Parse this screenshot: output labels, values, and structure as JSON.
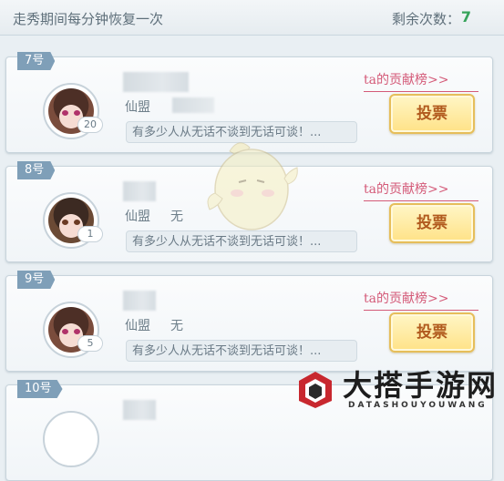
{
  "header": {
    "hint": "走秀期间每分钟恢复一次",
    "remaining_label": "剩余次数：",
    "remaining_count": "7"
  },
  "entries": [
    {
      "rank": "7号",
      "level": "20",
      "clan_label": "仙盟",
      "clan_value": "",
      "motto": "有多少人从无话不谈到无话可谈！...",
      "contrib_link": "ta的贡献榜>>",
      "vote_label": "投票"
    },
    {
      "rank": "8号",
      "level": "1",
      "clan_label": "仙盟",
      "clan_value": "无",
      "motto": "有多少人从无话不谈到无话可谈！...",
      "contrib_link": "ta的贡献榜>>",
      "vote_label": "投票"
    },
    {
      "rank": "9号",
      "level": "5",
      "clan_label": "仙盟",
      "clan_value": "无",
      "motto": "有多少人从无话不谈到无话可谈！...",
      "contrib_link": "ta的贡献榜>>",
      "vote_label": "投票"
    },
    {
      "rank": "10号"
    }
  ],
  "watermark": {
    "title": "大搭手游网",
    "subtitle": "DATASHOUYOUWANG"
  },
  "colors": {
    "remaining_count": "#36a35a",
    "contrib_link": "#d45a78",
    "vote_button": "#ffe287",
    "rank_tag": "#7f9fb8"
  }
}
